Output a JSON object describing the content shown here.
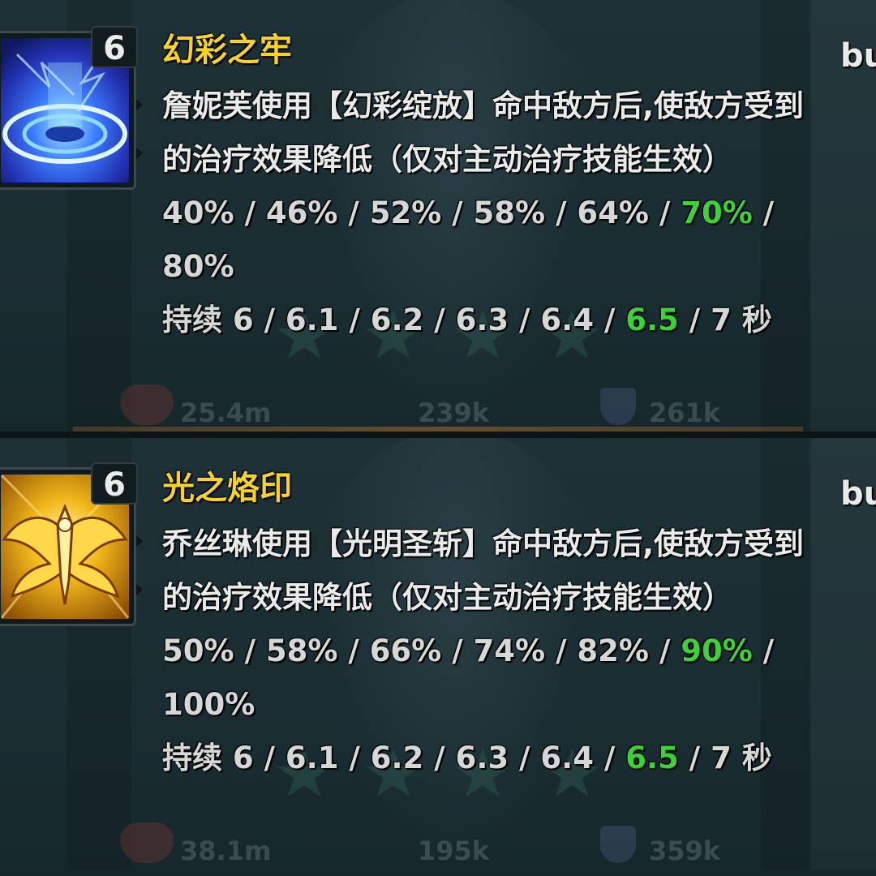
{
  "colors": {
    "name": "#f7d327",
    "text": "#e9eaea",
    "highlight": "#3fd03a",
    "background": "#1a2d32"
  },
  "skills": [
    {
      "level": "6",
      "name": "幻彩之牢",
      "description": "詹妮芙使用【幻彩绽放】命中敌方后,使敌方受到的治疗效果降低（仅对主动治疗技能生效）",
      "values": [
        "40%",
        "46%",
        "52%",
        "58%",
        "64%",
        "70%",
        "80%"
      ],
      "highlight_index": 5,
      "duration_label": "持续",
      "durations": [
        "6",
        "6.1",
        "6.2",
        "6.3",
        "6.4",
        "6.5",
        "7"
      ],
      "duration_unit": "秒",
      "side_label": "bu",
      "icon": "blue-portal-icon",
      "bg_stats": [
        "25.4m",
        "239k",
        "261k"
      ]
    },
    {
      "level": "6",
      "name": "光之烙印",
      "description": "乔丝琳使用【光明圣斩】命中敌方后,使敌方受到的治疗效果降低（仅对主动治疗技能生效）",
      "values": [
        "50%",
        "58%",
        "66%",
        "74%",
        "82%",
        "90%",
        "100%"
      ],
      "highlight_index": 5,
      "duration_label": "持续",
      "durations": [
        "6",
        "6.1",
        "6.2",
        "6.3",
        "6.4",
        "6.5",
        "7"
      ],
      "duration_unit": "秒",
      "side_label": "bu",
      "icon": "golden-winged-emblem-icon",
      "bg_stats": [
        "38.1m",
        "195k",
        "359k"
      ]
    }
  ]
}
